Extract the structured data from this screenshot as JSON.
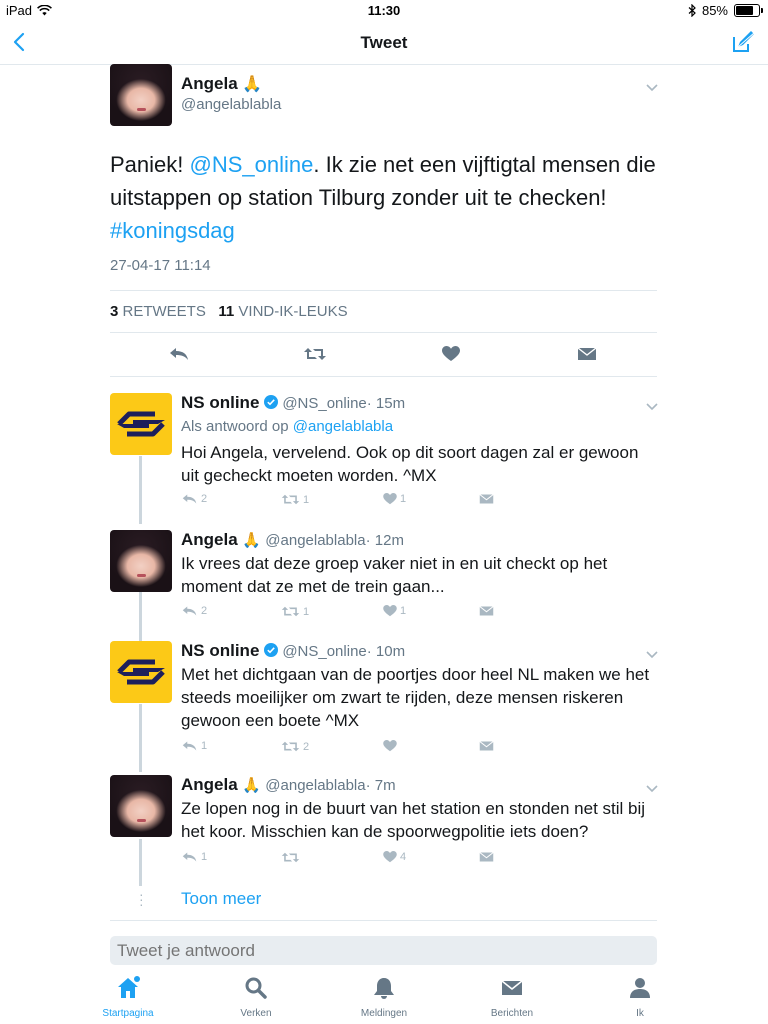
{
  "status_bar": {
    "device": "iPad",
    "time": "11:30",
    "battery": "85%",
    "battery_level": 0.85
  },
  "nav": {
    "title": "Tweet",
    "back_icon": "chevron-left-icon",
    "compose_icon": "compose-icon"
  },
  "tweet": {
    "name": "Angela",
    "emoji": "🙏",
    "handle": "@angelablabla",
    "text_1": "Paniek! ",
    "mention": "@NS_online",
    "text_2": ". Ik zie net een vijftigtal mensen die uitstappen op station Tilburg zonder uit te checken! ",
    "hashtag": "#koningsdag",
    "date": "27-04-17 11:14",
    "retweets_count": "3",
    "retweets_label": "RETWEETS",
    "likes_count": "11",
    "likes_label": "VIND-IK-LEUKS"
  },
  "replies": [
    {
      "name": "NS online",
      "handle": "@NS_online",
      "time": "· 15m",
      "reply_to_prefix": "Als antwoord op",
      "reply_to": "@angelablabla",
      "text": "Hoi Angela, vervelend. Ook op dit soort dagen zal er gewoon uit gecheckt moeten worden. ^MX",
      "replies": "2",
      "retweets": "1",
      "likes": "1"
    },
    {
      "name": "Angela",
      "emoji": "🙏",
      "handle": "@angelablabla",
      "time": "· 12m",
      "text": "Ik vrees dat deze groep vaker niet in en uit checkt op het moment dat ze met de trein gaan...",
      "replies": "2",
      "retweets": "1",
      "likes": "1"
    },
    {
      "name": "NS online",
      "handle": "@NS_online",
      "time": "· 10m",
      "text": "Met het dichtgaan van de poortjes door heel NL maken we het steeds moeilijker om zwart te rijden, deze mensen riskeren gewoon een boete ^MX",
      "replies": "1",
      "retweets": "2",
      "likes": ""
    },
    {
      "name": "Angela",
      "emoji": "🙏",
      "handle": "@angelablabla",
      "time": "· 7m",
      "text": "Ze lopen nog in de buurt van het station en stonden net stil bij het koor. Misschien kan de spoorwegpolitie iets doen?",
      "replies": "1",
      "retweets": "",
      "likes": "4"
    }
  ],
  "toon_meer": "Toon meer",
  "reply_input": {
    "placeholder": "Tweet je antwoord"
  },
  "tabs": [
    {
      "label": "Startpagina",
      "icon": "home-icon"
    },
    {
      "label": "Verken",
      "icon": "search-icon"
    },
    {
      "label": "Meldingen",
      "icon": "bell-icon"
    },
    {
      "label": "Berichten",
      "icon": "envelope-icon"
    },
    {
      "label": "Ik",
      "icon": "person-icon"
    }
  ],
  "colors": {
    "accent": "#1da1f2",
    "ns_yellow": "#fcc917",
    "ns_blue": "#1d1f5b",
    "verified": "#1da1f2"
  }
}
